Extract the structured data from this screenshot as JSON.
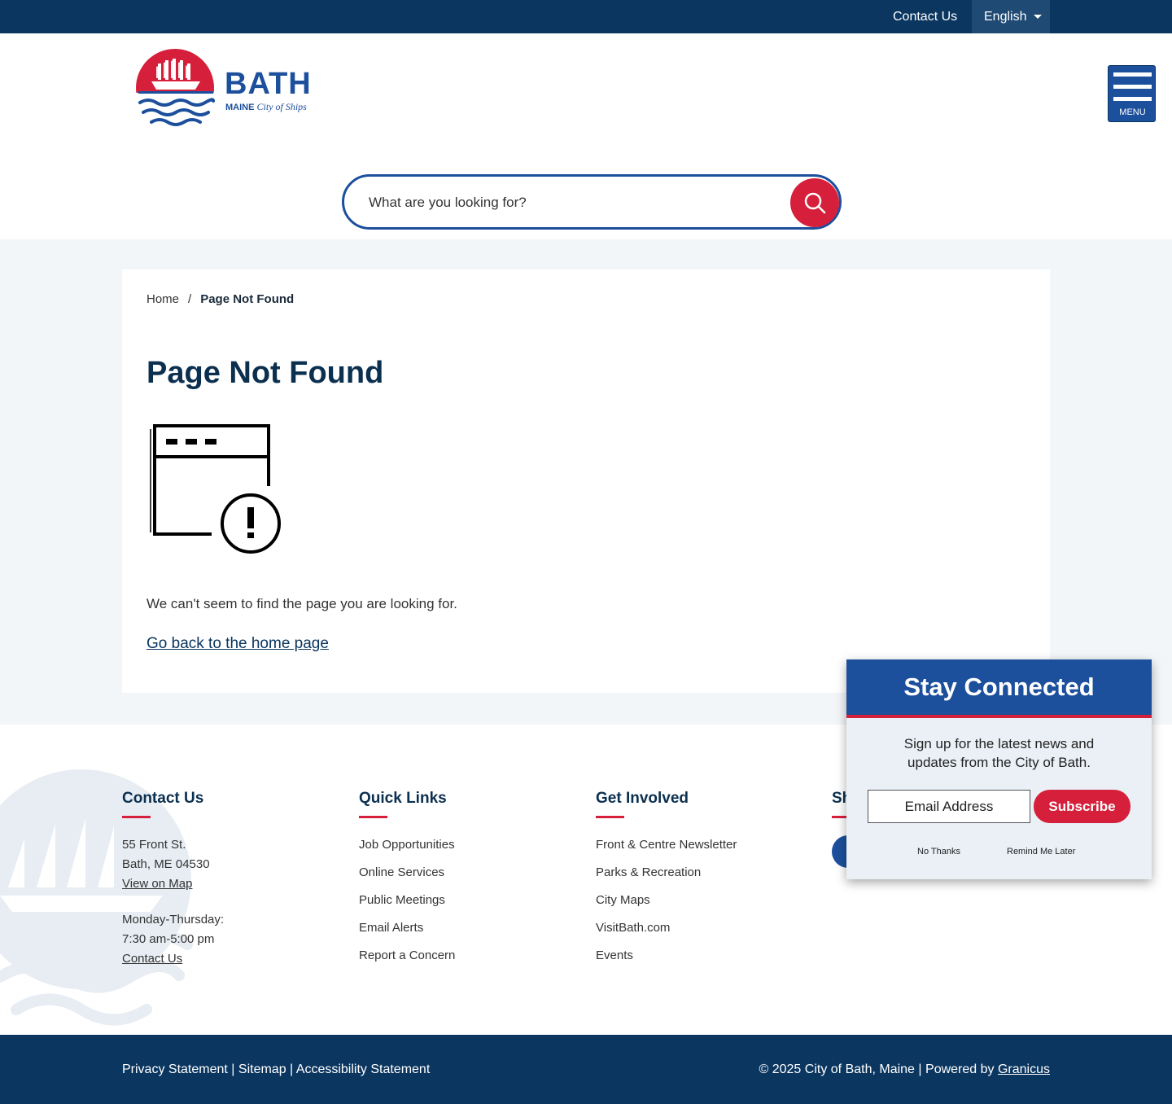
{
  "topbar": {
    "contact": "Contact Us",
    "language": "English"
  },
  "header": {
    "logo_word": "BATH",
    "logo_state": "MAINE",
    "logo_tagline": "City of Ships",
    "menu_label": "MENU",
    "search_placeholder": "What are you looking for?"
  },
  "breadcrumb": {
    "home": "Home",
    "separator": "/",
    "current": "Page Not Found"
  },
  "main": {
    "title": "Page Not Found",
    "message": "We can't seem to find the page you are looking for.",
    "home_link": "Go back to the home page"
  },
  "footer": {
    "contact": {
      "heading": "Contact Us",
      "street": "55 Front St.",
      "city": "Bath, ME 04530",
      "map_link": "View on Map",
      "hours_days": "Monday-Thursday:",
      "hours_time": "7:30 am-5:00 pm",
      "contact_link": "Contact Us"
    },
    "quick_links": {
      "heading": "Quick Links",
      "items": [
        "Job Opportunities",
        "Online Services",
        "Public Meetings",
        "Email Alerts",
        "Report a Concern"
      ]
    },
    "get_involved": {
      "heading": "Get Involved",
      "items": [
        "Front & Centre Newsletter",
        "Parks & Recreation",
        "City Maps",
        "VisitBath.com",
        "Events"
      ]
    },
    "share_heading_peek": "Sh"
  },
  "bottom": {
    "privacy": "Privacy Statement",
    "sitemap": "Sitemap",
    "accessibility": "Accessibility Statement",
    "divider": "|",
    "copyright": "© 2025 City of Bath, Maine",
    "powered_by": "Powered by",
    "granicus": "Granicus"
  },
  "popup": {
    "title": "Stay Connected",
    "body_line1": "Sign up for the latest news and",
    "body_line2": "updates from the City of Bath.",
    "email_placeholder": "Email Address",
    "subscribe": "Subscribe",
    "no_thanks": "No Thanks",
    "remind_later": "Remind Me Later"
  },
  "colors": {
    "navy": "#0b3660",
    "brand_blue": "#1c4f9c",
    "accent_red": "#d61f3a",
    "band_bg": "#f3f6f9"
  }
}
